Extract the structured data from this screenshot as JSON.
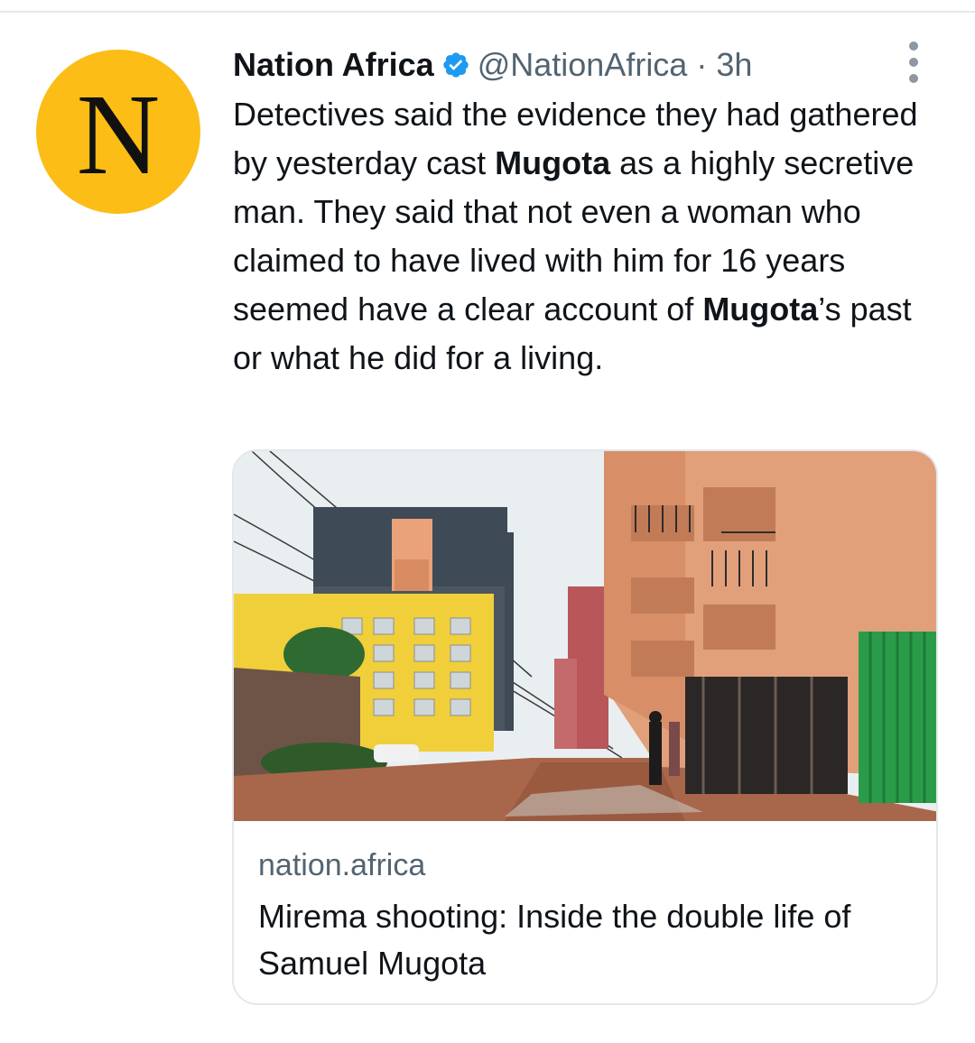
{
  "tweet": {
    "avatar_letter": "N",
    "author_name": "Nation Africa",
    "handle": "@NationAfrica",
    "separator": "·",
    "time": "3h",
    "text_parts": [
      "Detectives said the evidence they had gathered by yesterday cast ",
      "Mugota",
      " as a highly secretive man. They said that not even a woman who claimed to have lived with him for 16 years seemed have a clear account of ",
      "Mugota",
      "’s past or what he did for a living."
    ]
  },
  "card": {
    "domain": "nation.africa",
    "title": "Mirema shooting: Inside the double life of Samuel Mugota"
  },
  "colors": {
    "avatar_bg": "#fbbd16",
    "verified_blue": "#1d9bf0",
    "secondary_text": "#536471",
    "gate_green": "#2a9c49"
  },
  "icons": {
    "verified": "verified-badge-icon",
    "more": "more-options-icon"
  }
}
